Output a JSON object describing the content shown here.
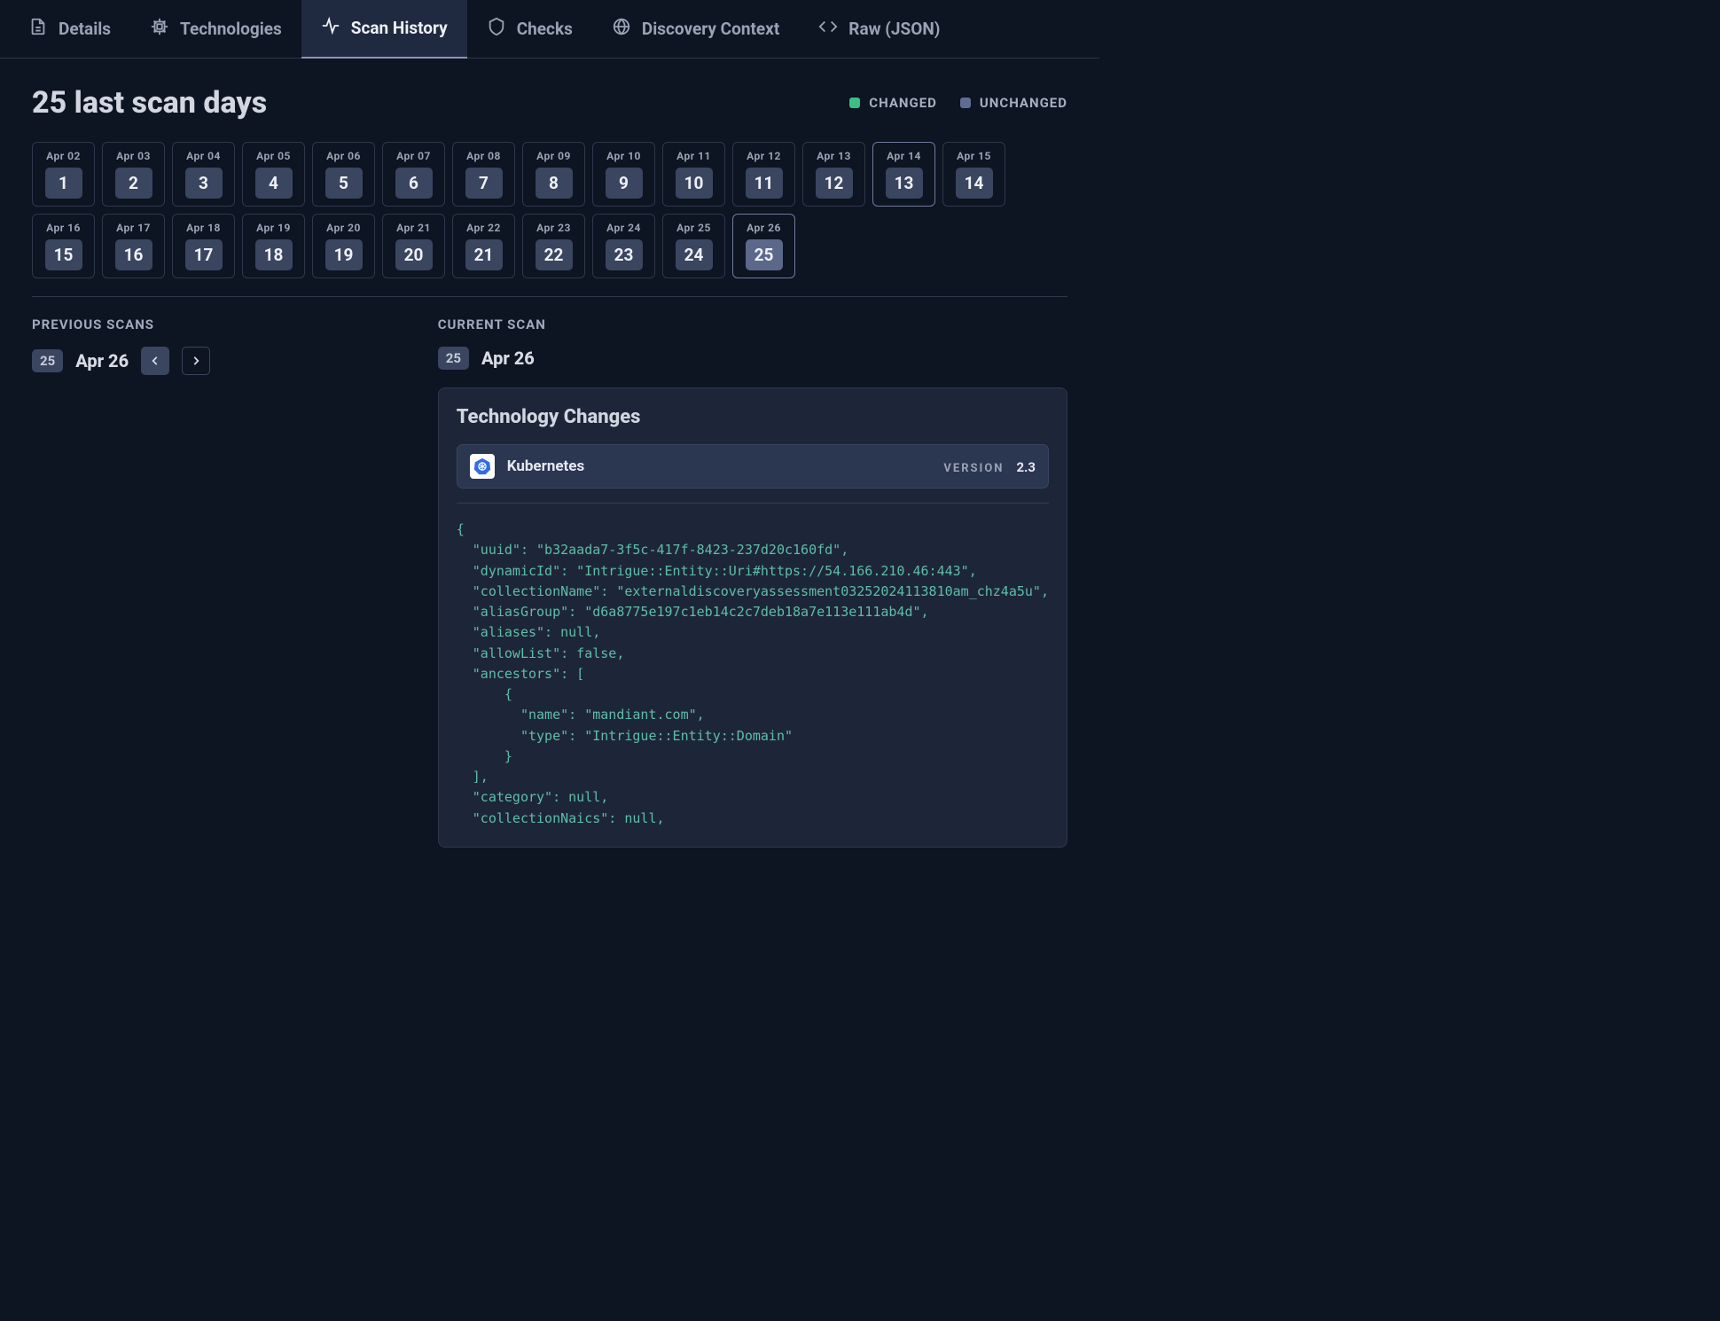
{
  "tabs": [
    {
      "label": "Details"
    },
    {
      "label": "Technologies"
    },
    {
      "label": "Scan History"
    },
    {
      "label": "Checks"
    },
    {
      "label": "Discovery Context"
    },
    {
      "label": "Raw (JSON)"
    }
  ],
  "heading": "25 last scan days",
  "legend": {
    "changed": "CHANGED",
    "unchanged": "UNCHANGED"
  },
  "days": [
    {
      "label": "Apr 02",
      "num": "1"
    },
    {
      "label": "Apr 03",
      "num": "2"
    },
    {
      "label": "Apr 04",
      "num": "3"
    },
    {
      "label": "Apr 05",
      "num": "4"
    },
    {
      "label": "Apr 06",
      "num": "5"
    },
    {
      "label": "Apr 07",
      "num": "6"
    },
    {
      "label": "Apr 08",
      "num": "7"
    },
    {
      "label": "Apr 09",
      "num": "8"
    },
    {
      "label": "Apr 10",
      "num": "9"
    },
    {
      "label": "Apr 11",
      "num": "10"
    },
    {
      "label": "Apr 12",
      "num": "11"
    },
    {
      "label": "Apr 13",
      "num": "12"
    },
    {
      "label": "Apr 14",
      "num": "13"
    },
    {
      "label": "Apr 15",
      "num": "14"
    },
    {
      "label": "Apr 16",
      "num": "15"
    },
    {
      "label": "Apr 17",
      "num": "16"
    },
    {
      "label": "Apr 18",
      "num": "17"
    },
    {
      "label": "Apr 19",
      "num": "18"
    },
    {
      "label": "Apr 20",
      "num": "19"
    },
    {
      "label": "Apr 21",
      "num": "20"
    },
    {
      "label": "Apr 22",
      "num": "21"
    },
    {
      "label": "Apr 23",
      "num": "22"
    },
    {
      "label": "Apr 24",
      "num": "23"
    },
    {
      "label": "Apr 25",
      "num": "24"
    },
    {
      "label": "Apr 26",
      "num": "25"
    }
  ],
  "previous": {
    "section_label": "PREVIOUS SCANS",
    "badge": "25",
    "date": "Apr 26"
  },
  "current": {
    "section_label": "CURRENT SCAN",
    "badge": "25",
    "date": "Apr 26"
  },
  "tech_panel": {
    "title": "Technology Changes",
    "item": {
      "name": "Kubernetes",
      "version_label": "VERSION",
      "version": "2.3"
    },
    "json_text": "{\n  \"uuid\": \"b32aada7-3f5c-417f-8423-237d20c160fd\",\n  \"dynamicId\": \"Intrigue::Entity::Uri#https://54.166.210.46:443\",\n  \"collectionName\": \"externaldiscoveryassessment03252024113810am_chz4a5u\",\n  \"aliasGroup\": \"d6a8775e197c1eb14c2c7deb18a7e113e111ab4d\",\n  \"aliases\": null,\n  \"allowList\": false,\n  \"ancestors\": [\n      {\n        \"name\": \"mandiant.com\",\n        \"type\": \"Intrigue::Entity::Domain\"\n      }\n  ],\n  \"category\": null,\n  \"collectionNaics\": null,"
  }
}
